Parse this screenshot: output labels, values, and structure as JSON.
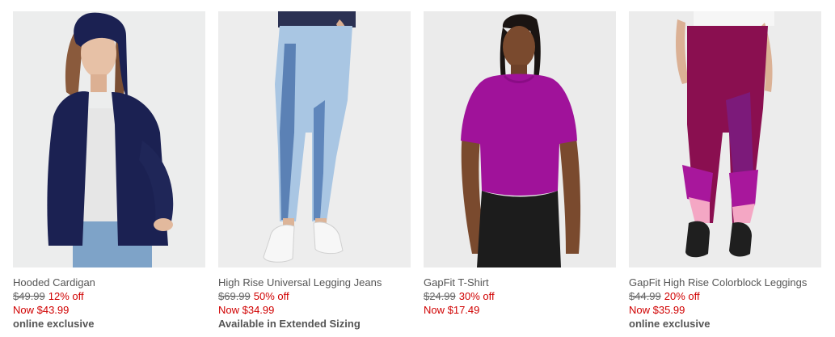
{
  "products": [
    {
      "name": "Hooded Cardigan",
      "original_price": "$49.99",
      "discount": "12% off",
      "sale_price": "Now $43.99",
      "badge": "online exclusive",
      "image_icon": "model-hooded-cardigan-image"
    },
    {
      "name": "High Rise Universal Legging Jeans",
      "original_price": "$69.99",
      "discount": "50% off",
      "sale_price": "Now $34.99",
      "badge": "Available in Extended Sizing",
      "image_icon": "model-legging-jeans-image"
    },
    {
      "name": "GapFit T-Shirt",
      "original_price": "$24.99",
      "discount": "30% off",
      "sale_price": "Now $17.49",
      "badge": "",
      "image_icon": "model-gapfit-tshirt-image"
    },
    {
      "name": "GapFit High Rise Colorblock Leggings",
      "original_price": "$44.99",
      "discount": "20% off",
      "sale_price": "Now $35.99",
      "badge": "online exclusive",
      "image_icon": "model-colorblock-leggings-image"
    }
  ],
  "colors": {
    "sale_red": "#d00000",
    "text_gray": "#555555",
    "photo_bg": "#eeeeee"
  }
}
